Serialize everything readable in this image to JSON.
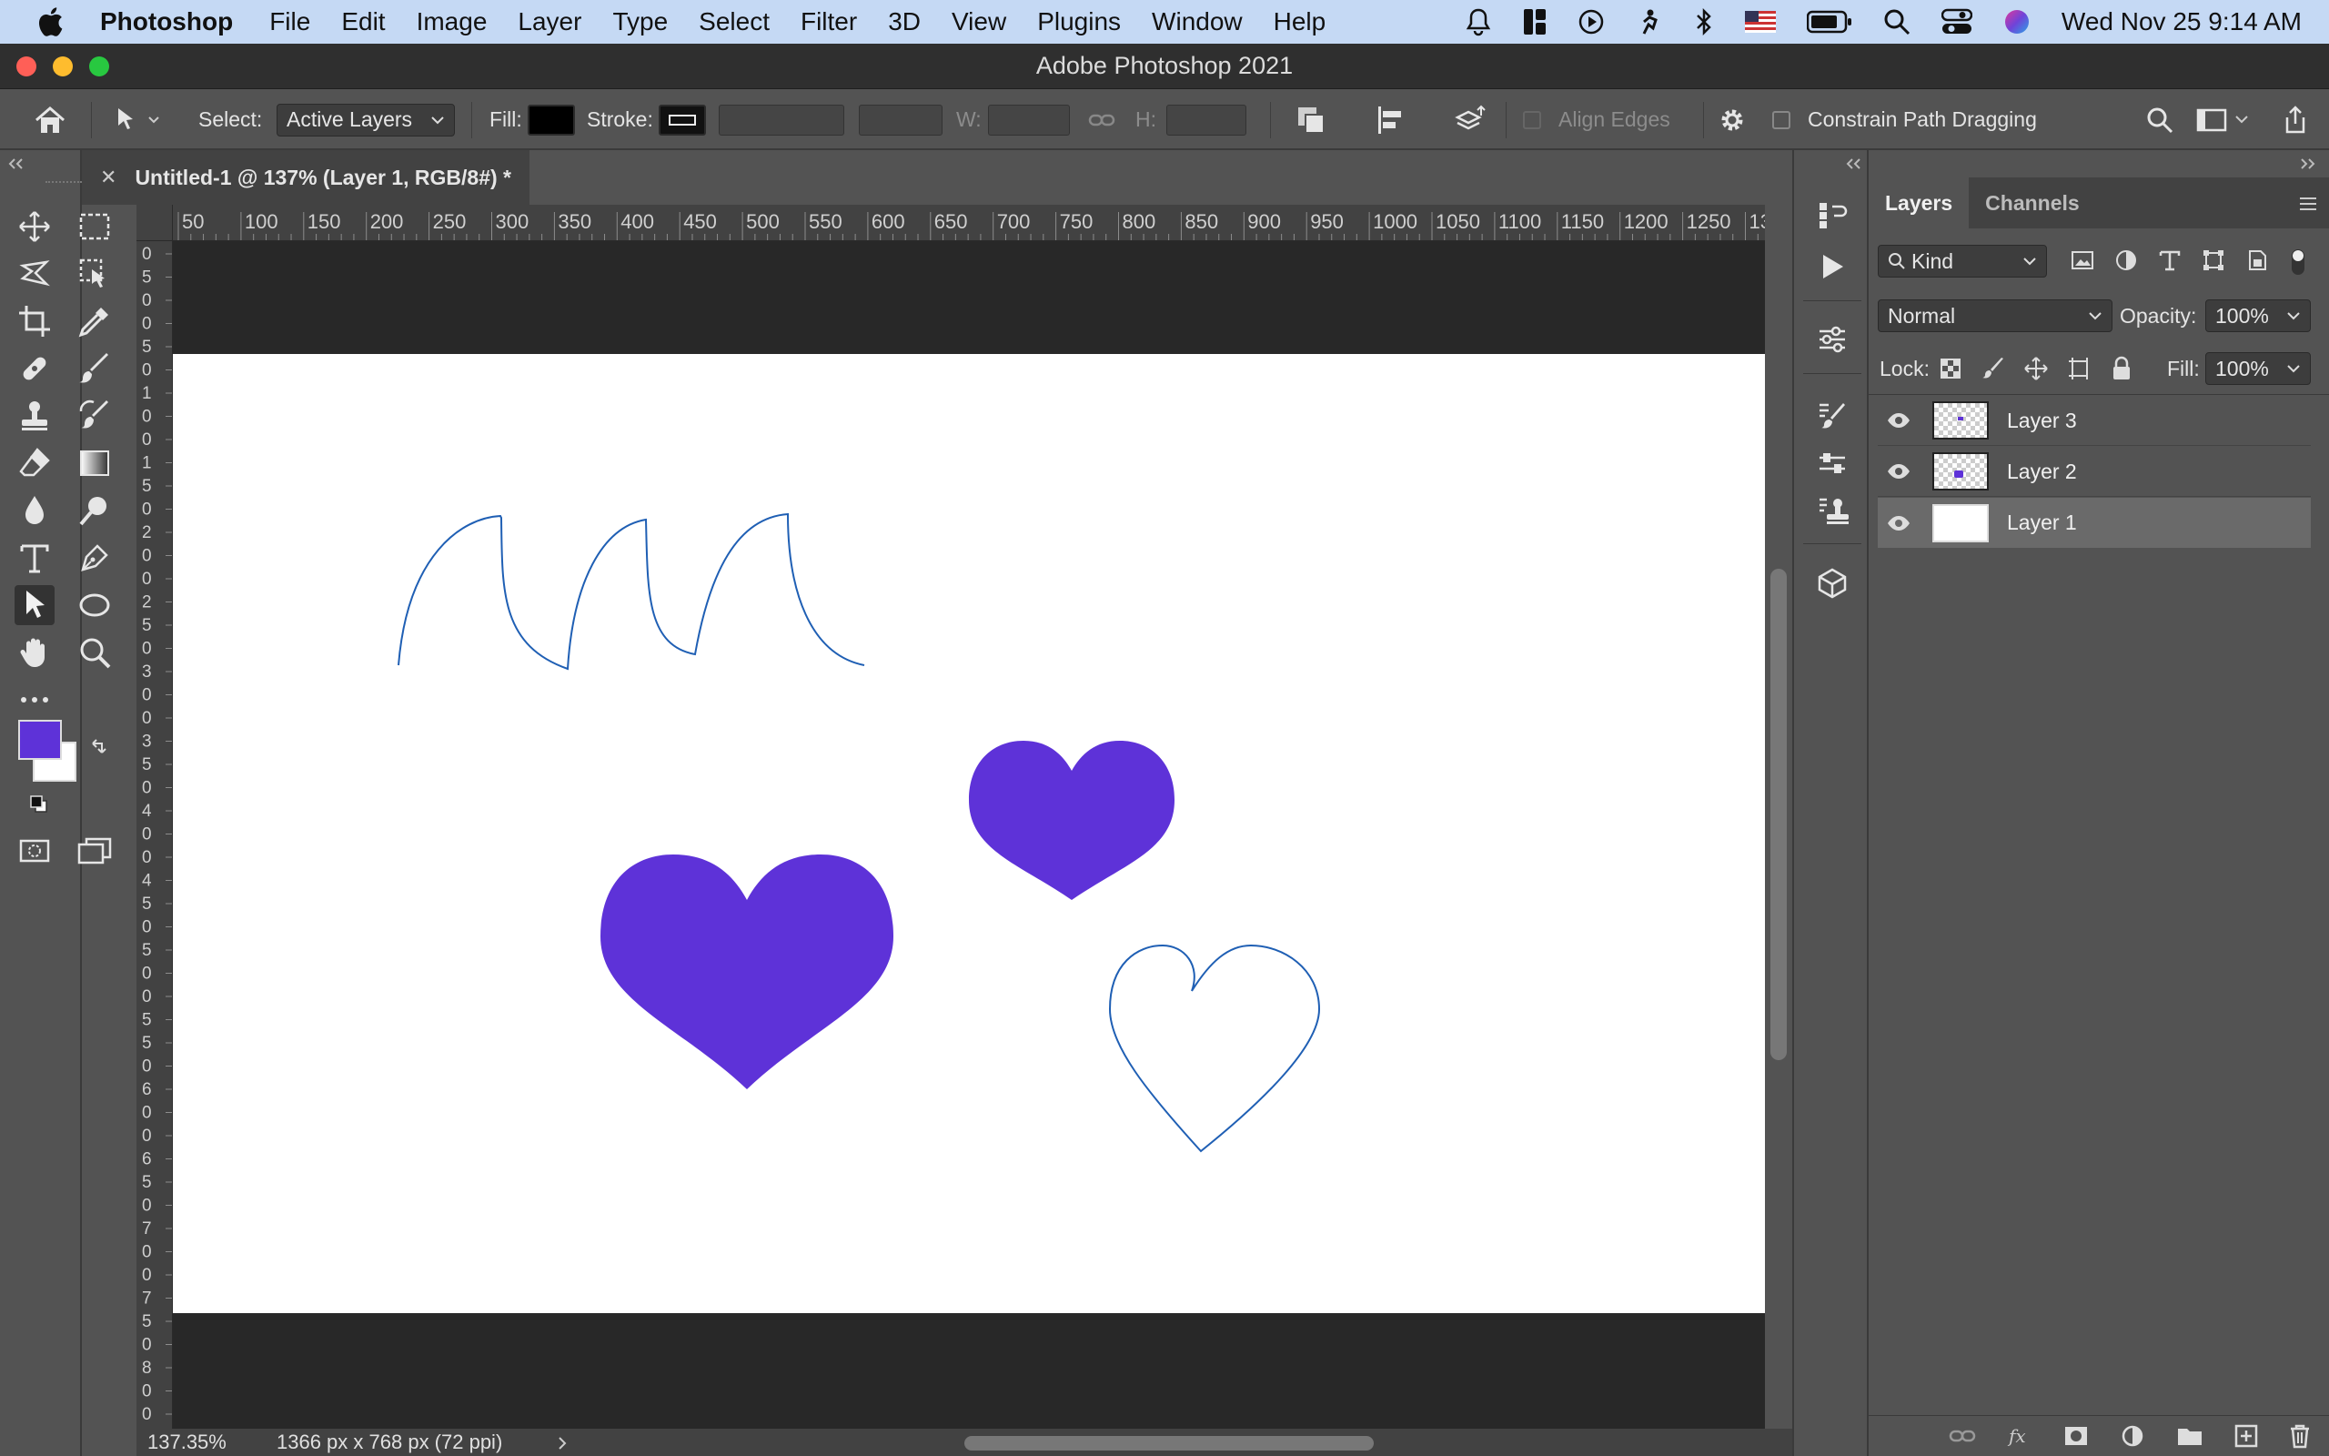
{
  "menubar": {
    "app_name": "Photoshop",
    "items": [
      "File",
      "Edit",
      "Image",
      "Layer",
      "Type",
      "Select",
      "Filter",
      "3D",
      "View",
      "Plugins",
      "Window",
      "Help"
    ],
    "clock": "Wed Nov 25  9:14 AM"
  },
  "window": {
    "title": "Adobe Photoshop 2021"
  },
  "options": {
    "select_label": "Select:",
    "select_value": "Active Layers",
    "fill_label": "Fill:",
    "stroke_label": "Stroke:",
    "w_label": "W:",
    "h_label": "H:",
    "align_edges": "Align Edges",
    "constrain": "Constrain Path Dragging"
  },
  "colors": {
    "foreground": "#5e32d8",
    "background": "#ffffff",
    "path_stroke": "#1f5fb4"
  },
  "document": {
    "tab_title": "Untitled-1 @ 137% (Layer 1, RGB/8#) *",
    "zoom": "137.35%",
    "size_info": "1366 px x 768 px (72 ppi)"
  },
  "ruler": {
    "top_ticks": [
      "50",
      "100",
      "150",
      "200",
      "250",
      "300",
      "350",
      "400",
      "450",
      "500",
      "550",
      "600",
      "650",
      "700",
      "750",
      "800",
      "850",
      "900",
      "950",
      "1000",
      "1050",
      "1100",
      "1150",
      "1200",
      "1250",
      "13"
    ],
    "left_ticks": [
      "0",
      "5",
      "0",
      "0",
      "5",
      "0",
      "1",
      "0",
      "0",
      "1",
      "5",
      "0",
      "2",
      "0",
      "0",
      "2",
      "5",
      "0",
      "3",
      "0",
      "0",
      "3",
      "5",
      "0",
      "4",
      "0",
      "0",
      "4",
      "5",
      "0",
      "5",
      "0",
      "0",
      "5",
      "5",
      "0",
      "6",
      "0",
      "0",
      "6",
      "5",
      "0",
      "7",
      "0",
      "0",
      "7",
      "5",
      "0",
      "8",
      "0",
      "0"
    ]
  },
  "layers_panel": {
    "tabs": [
      "Layers",
      "Channels"
    ],
    "filter": "Kind",
    "blend_mode": "Normal",
    "opacity_label": "Opacity:",
    "opacity_value": "100%",
    "lock_label": "Lock:",
    "fill_label": "Fill:",
    "fill_value": "100%",
    "layers": [
      {
        "name": "Layer 3",
        "selected": false
      },
      {
        "name": "Layer 2",
        "selected": false
      },
      {
        "name": "Layer 1",
        "selected": true
      }
    ]
  }
}
